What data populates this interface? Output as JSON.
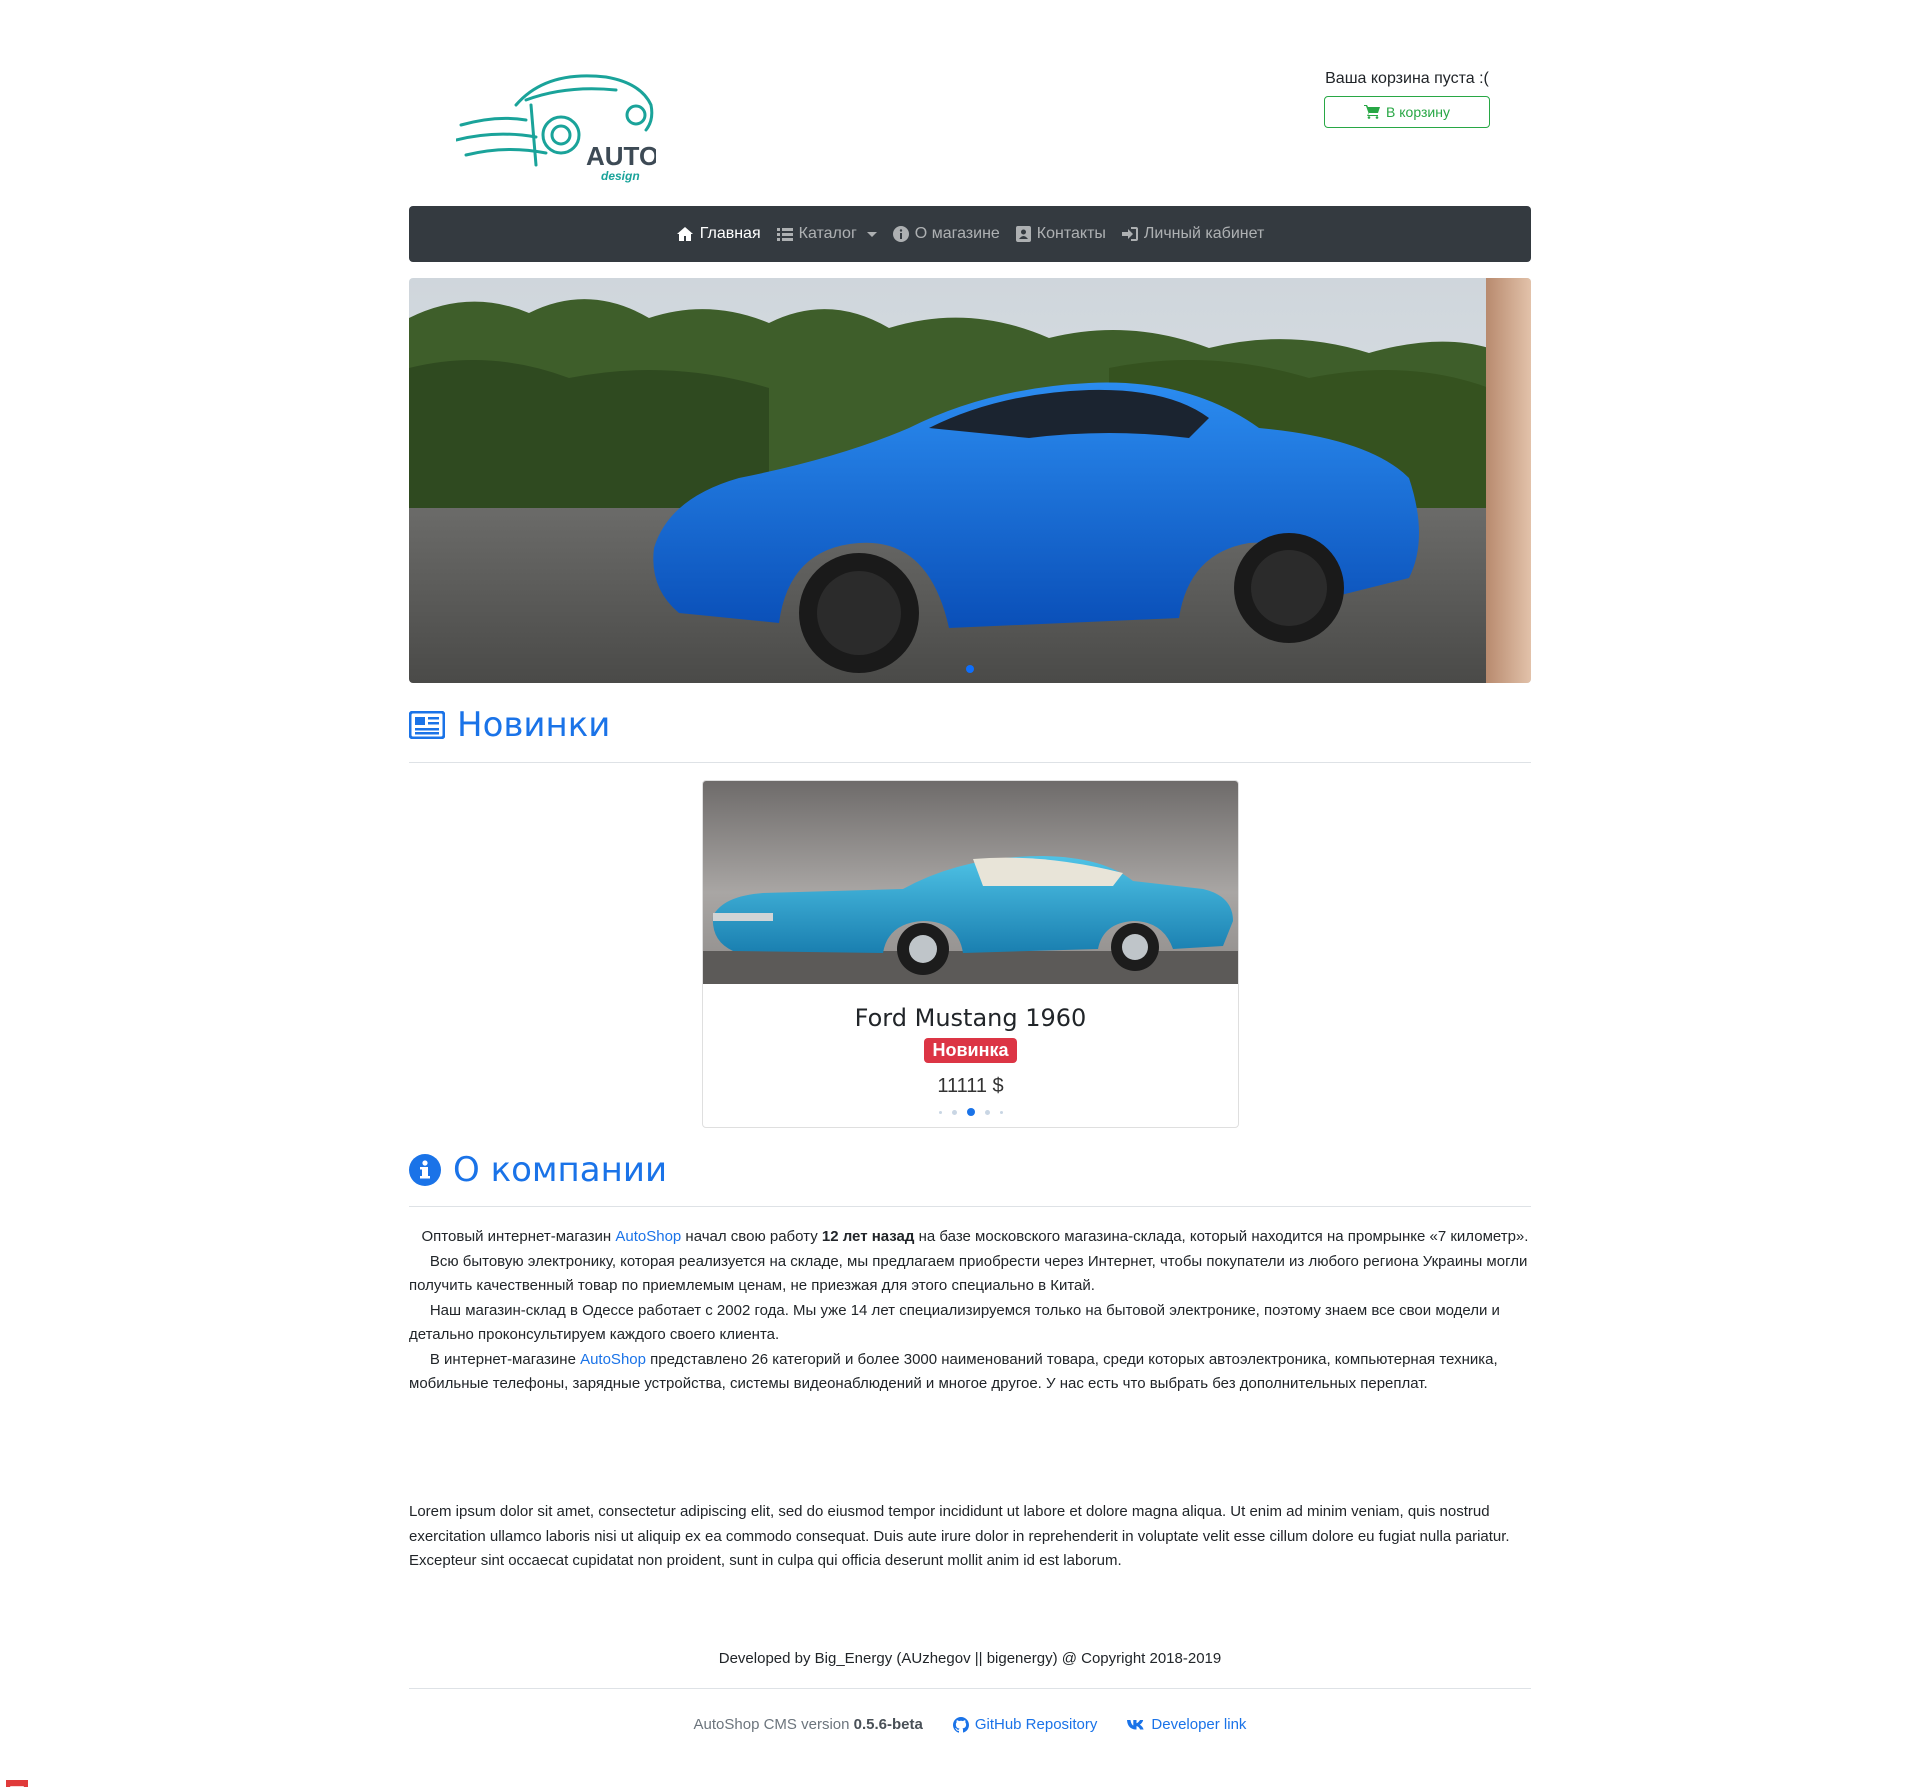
{
  "header": {
    "logo_text": "AUTO",
    "logo_sub": "design",
    "cart_status": "Ваша корзина пуста :(",
    "cart_button": "В корзину"
  },
  "nav": {
    "items": [
      {
        "label": "Главная",
        "icon": "home-icon"
      },
      {
        "label": "Каталог",
        "icon": "list-icon"
      },
      {
        "label": "О магазине",
        "icon": "info-icon"
      },
      {
        "label": "Контакты",
        "icon": "contact-icon"
      },
      {
        "label": "Личный кабинет",
        "icon": "sign-in-icon"
      }
    ]
  },
  "news": {
    "title": "Новинки",
    "product": {
      "name": "Ford Mustang 1960",
      "badge": "Новинка",
      "price": "11111 $"
    }
  },
  "about": {
    "title": "О компании",
    "p1_a": "Оптовый интернет-магазин ",
    "p1_link": "AutoShop",
    "p1_b": " начал свою работу ",
    "p1_bold": "12 лет назад",
    "p1_c": " на базе московского магазина-склада, который находится на промрынке «7 километр».",
    "p2": "Всю бытовую электронику, которая реализуется на складе, мы предлагаем приобрести через Интернет, чтобы покупатели из любого региона Украины могли получить качественный товар по приемлемым ценам, не приезжая для этого специально в Китай.",
    "p3": "Наш магазин-склад в Одессе работает с 2002 года. Мы уже 14 лет специализируемся только на бытовой электронике, поэтому знаем все свои модели и детально проконсультируем каждого своего клиента.",
    "p4_a": "В интернет-магазине ",
    "p4_link": "AutoShop",
    "p4_b": " представлено 26 категорий и более 3000 наименований товара, среди которых автоэлектроника, компьютерная техника, мобильные телефоны, зарядные устройства, системы видеонаблюдений и многое другое. У нас есть что выбрать без дополнительных переплат.",
    "lorem": "Lorem ipsum dolor sit amet, consectetur adipiscing elit, sed do eiusmod tempor incididunt ut labore et dolore magna aliqua. Ut enim ad minim veniam, quis nostrud exercitation ullamco laboris nisi ut aliquip ex ea commodo consequat. Duis aute irure dolor in reprehenderit in voluptate velit esse cillum dolore eu fugiat nulla pariatur. Excepteur sint occaecat cupidatat non proident, sunt in culpa qui officia deserunt mollit anim id est laborum."
  },
  "footer": {
    "developed": "Developed by Big_Energy (AUzhegov || bigenergy) @ Copyright 2018-2019",
    "version_label": "AutoShop CMS version ",
    "version": "0.5.6-beta",
    "github": "GitHub Repository",
    "developer": "Developer link"
  },
  "colors": {
    "accent": "#1a73e8",
    "navbar": "#343a40",
    "badge": "#dc3545",
    "cart": "#28a745",
    "logo": "#1aa39a"
  }
}
